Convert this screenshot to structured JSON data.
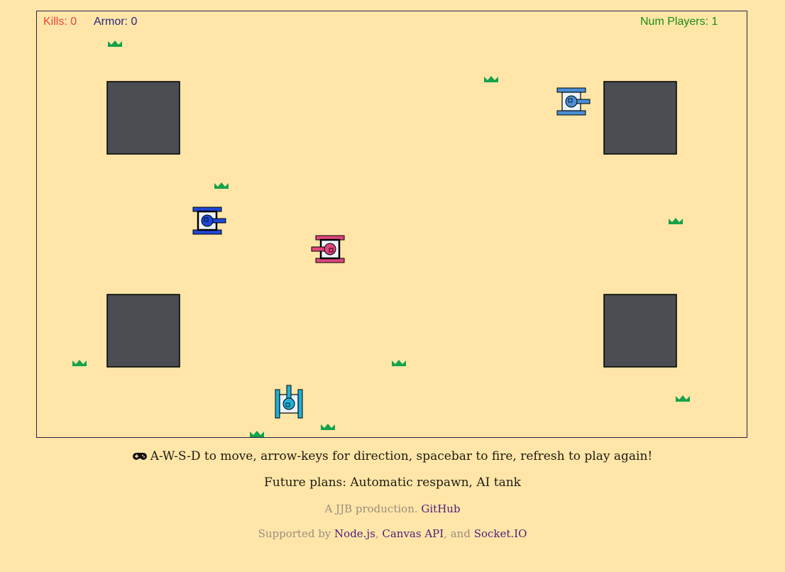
{
  "hud": {
    "kills": "Kills: 0",
    "armor": "Armor: 0",
    "num_players": "Num Players: 1",
    "colors": {
      "kills": "#e8453c",
      "armor": "#2b2280",
      "num_players": "#1a8a12"
    }
  },
  "arena": {
    "background": "#ffe6a8",
    "obstacle_color": "#4a4d52",
    "grass_color": "#15a24a"
  },
  "tanks": [
    {
      "name": "dark-blue-tank",
      "color": "#1d49d6",
      "facing": "right"
    },
    {
      "name": "pink-tank",
      "color": "#e0457d",
      "facing": "left"
    },
    {
      "name": "light-blue-tank",
      "color": "#4a8fd6",
      "facing": "right"
    },
    {
      "name": "cyan-tank",
      "color": "#1fb0d8",
      "facing": "up"
    }
  ],
  "footer": {
    "controls_icon": "gamepad-icon",
    "controls": "A-W-S-D to move, arrow-keys for direction, spacebar to fire, refresh to play again!",
    "future": "Future plans: Automatic respawn, AI tank",
    "credit_prefix": "A JJB production.",
    "credit_link": "GitHub",
    "supported_prefix": "Supported by",
    "supported_links": [
      "Node.js",
      "Canvas API",
      "Socket.IO"
    ],
    "supported_sep": ", ",
    "supported_and": ", and "
  }
}
